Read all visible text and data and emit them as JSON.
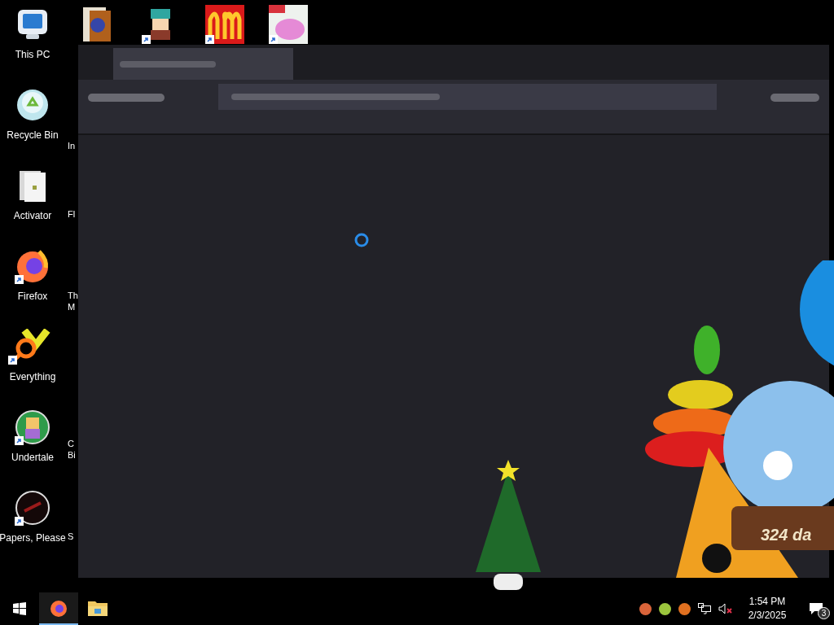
{
  "desktop_icons": [
    {
      "label": "This PC",
      "kind": "pc",
      "shortcut": false
    },
    {
      "label": "Recycle Bin",
      "kind": "bin",
      "shortcut": false
    },
    {
      "label": "Activator",
      "kind": "folder",
      "shortcut": false
    },
    {
      "label": "Firefox",
      "kind": "firefox",
      "shortcut": true
    },
    {
      "label": "Everything",
      "kind": "search",
      "shortcut": true
    },
    {
      "label": "Undertale",
      "kind": "game",
      "shortcut": true
    },
    {
      "label": "Papers, Please",
      "kind": "dark",
      "shortcut": true
    }
  ],
  "partial_icon_labels": [
    "In",
    "Fl",
    "Th",
    "M",
    "C",
    "Bi",
    "S"
  ],
  "top_icons": [
    {
      "kind": "book",
      "shortcut": false
    },
    {
      "kind": "character",
      "shortcut": true
    },
    {
      "kind": "arches",
      "shortcut": true
    },
    {
      "kind": "pig",
      "shortcut": true
    }
  ],
  "browser_window": {
    "loading": true
  },
  "snow_globe": {
    "countdown": "324 da"
  },
  "taskbar": {
    "apps": [
      {
        "kind": "firefox",
        "selected": true
      },
      {
        "kind": "explorer",
        "selected": false
      }
    ],
    "tray": [
      {
        "color": "#d9643a"
      },
      {
        "color": "#9bc53d"
      },
      {
        "color": "#e07020"
      }
    ],
    "time": "1:54 PM",
    "date": "2/3/2025",
    "notifications": "3",
    "muted": true
  }
}
